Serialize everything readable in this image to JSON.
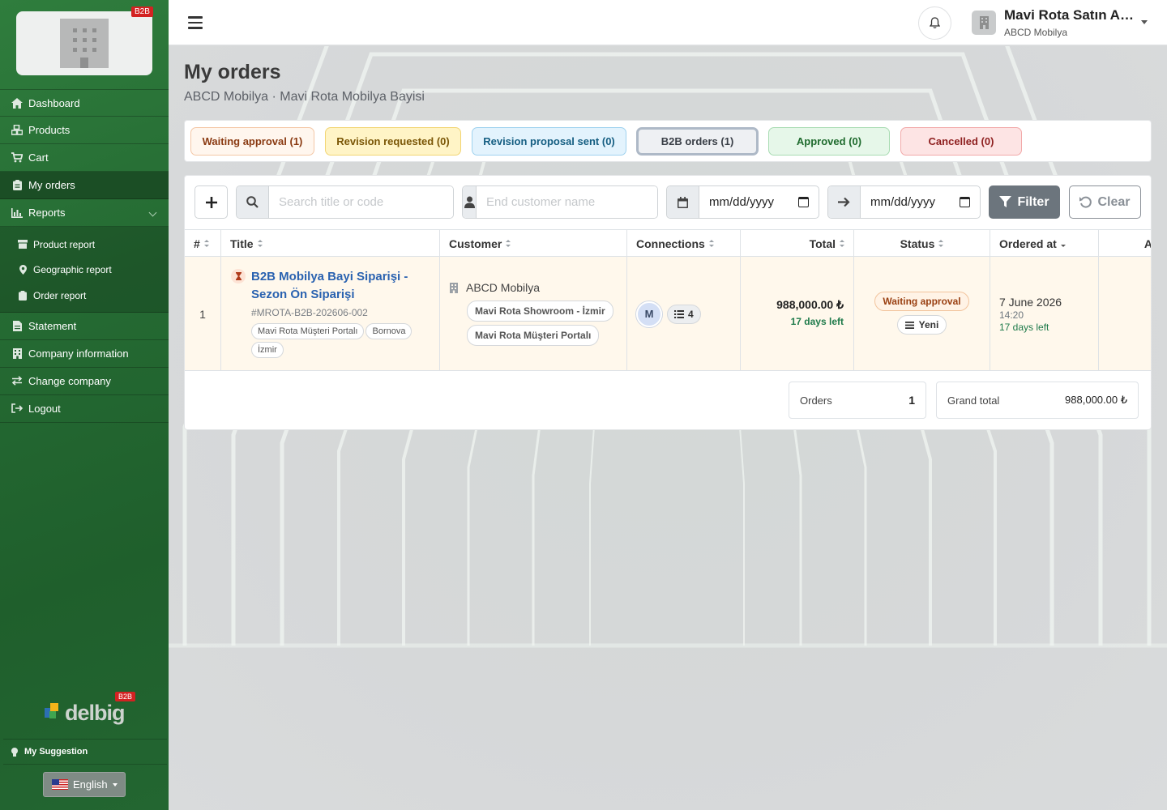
{
  "sidebar": {
    "badge": "B2B",
    "menu": [
      {
        "label": "Dashboard",
        "icon": "home-icon"
      },
      {
        "label": "Products",
        "icon": "cubes-icon"
      },
      {
        "label": "Cart",
        "icon": "cart-icon"
      },
      {
        "label": "My orders",
        "icon": "clipboard-icon",
        "active": true
      },
      {
        "label": "Reports",
        "icon": "chart-icon"
      }
    ],
    "reports_sub": [
      {
        "label": "Product report",
        "icon": "box-icon"
      },
      {
        "label": "Geographic report",
        "icon": "map-marker-icon"
      },
      {
        "label": "Order report",
        "icon": "clipboard-icon"
      }
    ],
    "menu2": [
      {
        "label": "Statement",
        "icon": "document-icon"
      },
      {
        "label": "Company information",
        "icon": "building-icon"
      },
      {
        "label": "Change company",
        "icon": "exchange-icon"
      },
      {
        "label": "Logout",
        "icon": "logout-icon"
      }
    ],
    "brand": "delbig",
    "brand_badge": "B2B",
    "suggestion": "My Suggestion",
    "language": "English"
  },
  "header": {
    "user_name": "Mavi Rota Satın Alma",
    "user_company": "ABCD Mobilya"
  },
  "page": {
    "title": "My orders",
    "subtitle": "ABCD Mobilya · Mavi Rota Mobilya Bayisi"
  },
  "tabs": [
    {
      "label": "Waiting approval (1)",
      "bg": "#fff6ee",
      "border": "#f4c7a6",
      "color": "#8a3a12"
    },
    {
      "label": "Revision requested (0)",
      "bg": "#fff4c6",
      "border": "#f2d574",
      "color": "#7a5606"
    },
    {
      "label": "Revision proposal sent (0)",
      "bg": "#e3f3fd",
      "border": "#9fd2ef",
      "color": "#155e82"
    },
    {
      "label": "B2B orders (1)",
      "bg": "#eef0f3",
      "border": "#aeb9c7",
      "color": "#3a3f47"
    },
    {
      "label": "Approved (0)",
      "bg": "#e6f7e9",
      "border": "#a9dcb3",
      "color": "#1f6b2e"
    },
    {
      "label": "Cancelled (0)",
      "bg": "#fde4e4",
      "border": "#f2a9a9",
      "color": "#8e1f1f"
    }
  ],
  "filters": {
    "search_placeholder": "Search title or code",
    "customer_placeholder": "End customer name",
    "date_from": "mm/dd/yyyy",
    "date_to": "mm/dd/yyyy",
    "filter_label": "Filter",
    "clear_label": "Clear"
  },
  "table": {
    "headers": [
      "#",
      "Title",
      "Customer",
      "Connections",
      "Total",
      "Status",
      "Ordered at",
      "A"
    ],
    "rows": [
      {
        "index": "1",
        "title": "B2B Mobilya Bayi Siparişi - Sezon Ön Siparişi",
        "code": "#MROTA-B2B-202606-002",
        "tags": [
          "Mavi Rota Müşteri Portalı",
          "Bornova",
          "İzmir"
        ],
        "customer": "ABCD Mobilya",
        "customer_tags": [
          "Mavi Rota Showroom - İzmir",
          "Mavi Rota Müşteri Portalı"
        ],
        "conn_avatar": "M",
        "conn_count": "4",
        "total": "988,000.00 ₺",
        "total_note": "17 days left",
        "status": "Waiting approval",
        "status_sub": "Yeni",
        "date": "7 June 2026",
        "time": "14:20",
        "date_note": "17 days left"
      }
    ]
  },
  "summary": {
    "orders_label": "Orders",
    "orders_value": "1",
    "grand_label": "Grand total",
    "grand_value": "988,000.00 ₺"
  }
}
